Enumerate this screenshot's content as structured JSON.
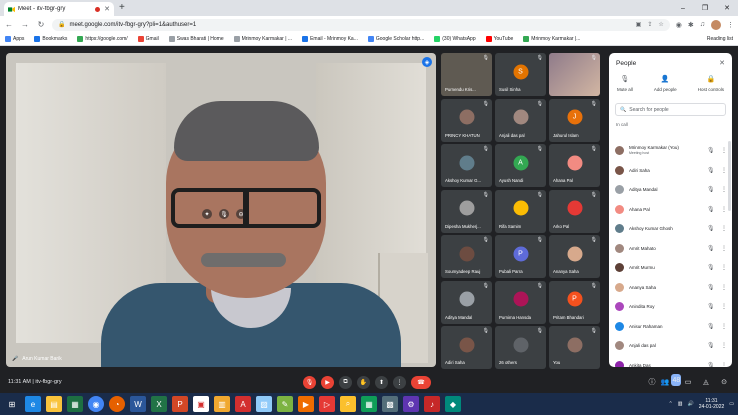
{
  "browser": {
    "tab_title": "Meet - itv-fbgr-gry",
    "new_tab": "+",
    "url": "meet.google.com/itv-fbgr-gry?pli=1&authuser=1",
    "window_controls": [
      "–",
      "❐",
      "✕"
    ]
  },
  "bookmarks": [
    {
      "label": "Apps",
      "color": "#4285f4"
    },
    {
      "label": "Bookmarks",
      "color": "#1a73e8"
    },
    {
      "label": "https://google.com/",
      "color": "#34a853"
    },
    {
      "label": "Gmail",
      "color": "#ea4335"
    },
    {
      "label": "Swas Bharati | Home",
      "color": "#9aa0a6"
    },
    {
      "label": "Mrinmoy Karmakar | ...",
      "color": "#9aa0a6"
    },
    {
      "label": "Email - Mrinmoy Ka...",
      "color": "#1a73e8"
    },
    {
      "label": "Google Scholar http...",
      "color": "#4285f4"
    },
    {
      "label": "(30) WhatsApp",
      "color": "#25d366"
    },
    {
      "label": "YouTube",
      "color": "#ff0000"
    },
    {
      "label": "Mrinmoy Karmakar |...",
      "color": "#34a853"
    }
  ],
  "reading_list": "Reading list",
  "main_video": {
    "name": "Arun Kumar Barik"
  },
  "tiles": [
    {
      "name": "Purnendu Kris...",
      "type": "video",
      "color": "#5f5a52"
    },
    {
      "name": "Susil Sinha",
      "initial": "S",
      "color": "#e37400"
    },
    {
      "name": "",
      "type": "video2",
      "color": "#c4a89b"
    },
    {
      "name": "PRINCY KHATUN",
      "color": "#8d6e63"
    },
    {
      "name": "Anjali das pal",
      "color": "#a1887f"
    },
    {
      "name": "Jahurul Islam",
      "initial": "J",
      "color": "#e8710a"
    },
    {
      "name": "Akshoy Kumar G...",
      "color": "#607d8b"
    },
    {
      "name": "Ayush Nandi",
      "initial": "A",
      "color": "#33a852"
    },
    {
      "name": "Ahana Pal",
      "color": "#f28b82"
    },
    {
      "name": "Dipesha Mukherj...",
      "color": "#9e9e9e"
    },
    {
      "name": "Rifa Samim",
      "color": "#fbbc04"
    },
    {
      "name": "Arko Pal",
      "color": "#e53935"
    },
    {
      "name": "Soumyadeep Rauj",
      "color": "#6d4c41"
    },
    {
      "name": "Pubali Parra",
      "initial": "P",
      "color": "#5e6bd8"
    },
    {
      "name": "Ananya Saha",
      "color": "#d7a98c"
    },
    {
      "name": "Aditya Mandal",
      "color": "#9aa0a6"
    },
    {
      "name": "Purnima Hansda",
      "color": "#ad1457"
    },
    {
      "name": "Pritam Bhandari",
      "initial": "P",
      "color": "#f4511e"
    },
    {
      "name": "Adiri Saha",
      "color": "#795548"
    },
    {
      "name": "26 others",
      "color": "#5f6368"
    },
    {
      "name": "You",
      "color": "#8d6e63"
    }
  ],
  "people_panel": {
    "title": "People",
    "close": "✕",
    "actions": [
      {
        "label": "Mute all",
        "icon": "🎙"
      },
      {
        "label": "Add people",
        "icon": "👤"
      },
      {
        "label": "Host controls",
        "icon": "🔒"
      }
    ],
    "search_placeholder": "Search for people",
    "section": "In call",
    "people": [
      {
        "name": "Mrinmoy Karmakar (You)",
        "sub": "Meeting host",
        "color": "#8d6e63"
      },
      {
        "name": "Adiri Saha",
        "color": "#795548"
      },
      {
        "name": "Aditya Mandal",
        "color": "#9aa0a6"
      },
      {
        "name": "Ahana Pal",
        "color": "#f28b82"
      },
      {
        "name": "Akshoy Kumar Ghosh",
        "color": "#607d8b"
      },
      {
        "name": "Amrit Mahato",
        "color": "#a1887f"
      },
      {
        "name": "Amrit Murmu",
        "color": "#5d4037"
      },
      {
        "name": "Ananya Saha",
        "color": "#d7a98c"
      },
      {
        "name": "Anindita Roy",
        "color": "#ab47bc"
      },
      {
        "name": "Anisur Rahaman",
        "color": "#1e88e5"
      },
      {
        "name": "Anjali das pal",
        "color": "#a1887f"
      },
      {
        "name": "Ankita Das",
        "color": "#8e24aa"
      }
    ]
  },
  "meeting_bar": {
    "info": "11:31 AM  |  itv-fbgr-gry",
    "participant_count": "48"
  },
  "taskbar": {
    "time": "11:31",
    "date": "24-01-2022"
  }
}
